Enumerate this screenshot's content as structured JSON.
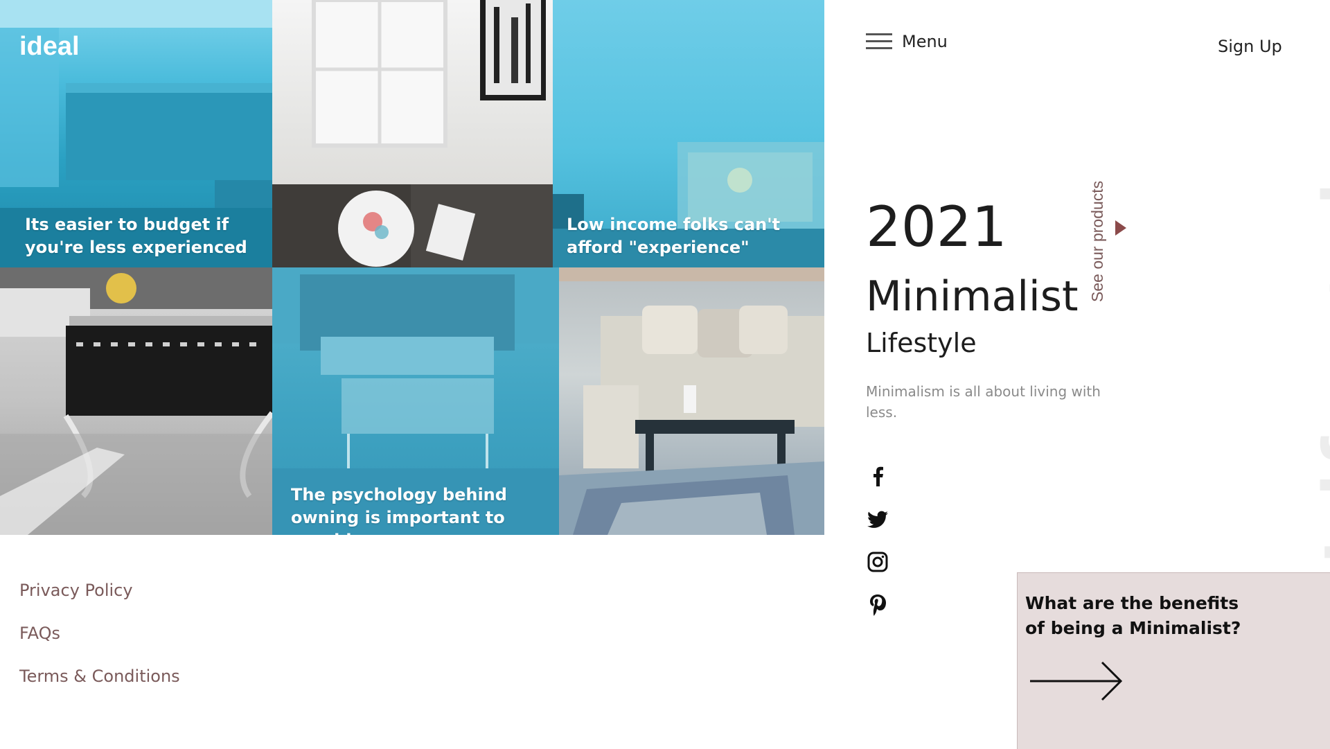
{
  "brand": {
    "logo": "ideal"
  },
  "nav": {
    "menu_label": "Menu",
    "signup_label": "Sign Up"
  },
  "tiles": [
    {
      "caption": "Its easier to budget if you're less experienced"
    },
    {
      "caption": ""
    },
    {
      "caption": "Low income folks can't afford \"experience\""
    },
    {
      "caption": ""
    },
    {
      "caption": "The psychology behind owning is important to consider"
    },
    {
      "caption": ""
    }
  ],
  "hero": {
    "year": "2021",
    "title": "Minimalist",
    "subtitle": "Lifestyle",
    "description": "Minimalism is all about living with less.",
    "see_products": "See our products",
    "watermark": "Lifestyle"
  },
  "social": [
    "facebook-icon",
    "twitter-icon",
    "instagram-icon",
    "pinterest-icon"
  ],
  "footer": {
    "links": [
      "Privacy Policy",
      "FAQs",
      "Terms & Conditions"
    ]
  },
  "card": {
    "title": "What are the benefits of being a Minimalist?"
  },
  "colors": {
    "accent": "#7a5a5a",
    "tile_blue": "#4bbcdc",
    "card_bg": "#e6dcdc"
  }
}
